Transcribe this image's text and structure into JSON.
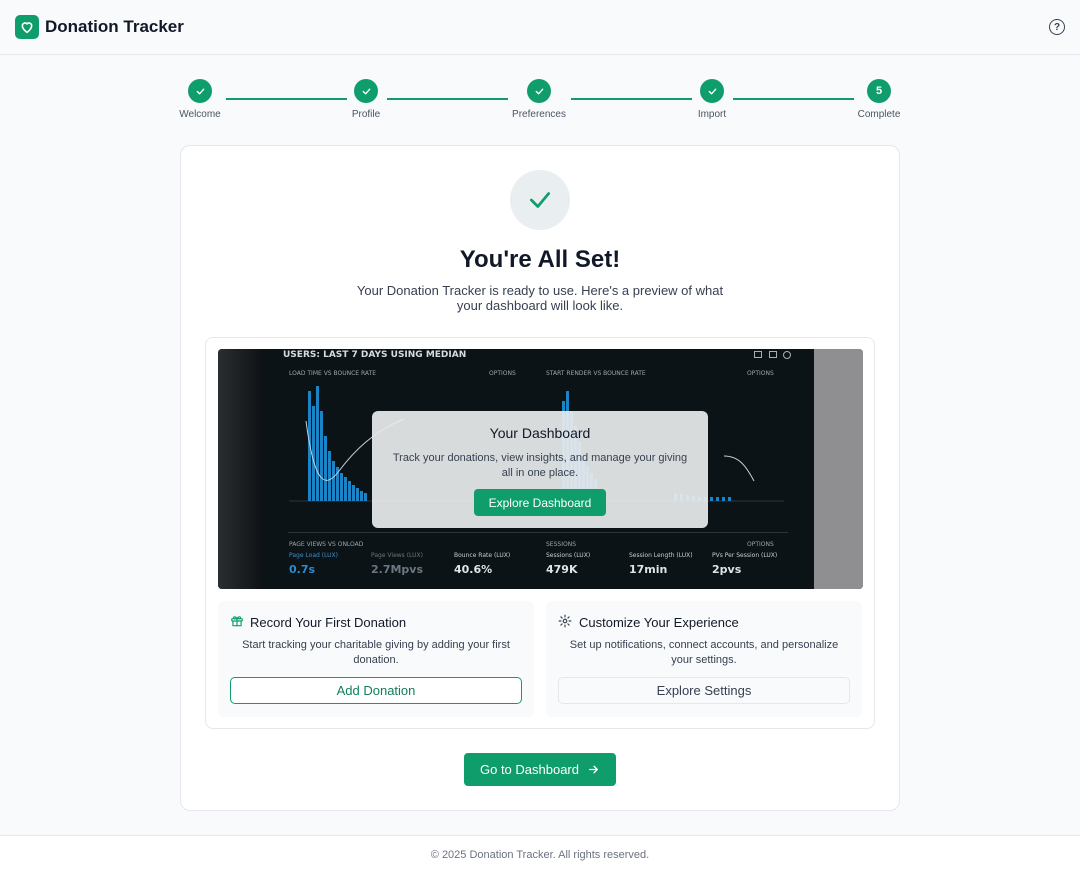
{
  "header": {
    "app_title": "Donation Tracker",
    "help_icon": "help-circle-icon"
  },
  "stepper": {
    "steps": [
      {
        "label": "Welcome",
        "state": "done"
      },
      {
        "label": "Profile",
        "state": "done"
      },
      {
        "label": "Preferences",
        "state": "done"
      },
      {
        "label": "Import",
        "state": "done"
      },
      {
        "label": "Complete",
        "number": "5",
        "state": "current"
      }
    ]
  },
  "main": {
    "title": "You're All Set!",
    "subtitle": "Your Donation Tracker is ready to use. Here's a preview of what your dashboard will look like."
  },
  "preview": {
    "screenshot": {
      "header": "USERS: LAST 7 DAYS USING MEDIAN",
      "panel_left": "LOAD TIME VS BOUNCE RATE",
      "panel_right": "START RENDER VS BOUNCE RATE",
      "options": "OPTIONS",
      "section_left": "PAGE VIEWS VS ONLOAD",
      "section_right": "SESSIONS",
      "metrics": [
        {
          "label": "Page Load (LUX)",
          "value": "0.7s"
        },
        {
          "label": "Page Views (LUX)",
          "value": "2.7Mpvs"
        },
        {
          "label": "Bounce Rate (LUX)",
          "value": "40.6%"
        },
        {
          "label": "Sessions (LUX)",
          "value": "479K"
        },
        {
          "label": "Session Length (LUX)",
          "value": "17min"
        },
        {
          "label": "PVs Per Session (LUX)",
          "value": "2pvs"
        }
      ]
    },
    "overlay": {
      "title": "Your Dashboard",
      "description": "Track your donations, view insights, and manage your giving all in one place.",
      "button": "Explore Dashboard"
    }
  },
  "actions": [
    {
      "icon": "gift-icon",
      "title": "Record Your First Donation",
      "description": "Start tracking your charitable giving by adding your first donation.",
      "button": "Add Donation"
    },
    {
      "icon": "gear-icon",
      "title": "Customize Your Experience",
      "description": "Set up notifications, connect accounts, and personalize your settings.",
      "button": "Explore Settings"
    }
  ],
  "cta": {
    "label": "Go to Dashboard",
    "icon": "arrow-right-icon"
  },
  "footer": {
    "text": "© 2025 Donation Tracker. All rights reserved."
  },
  "colors": {
    "accent": "#0f9d6c",
    "background": "#f8fafc"
  }
}
